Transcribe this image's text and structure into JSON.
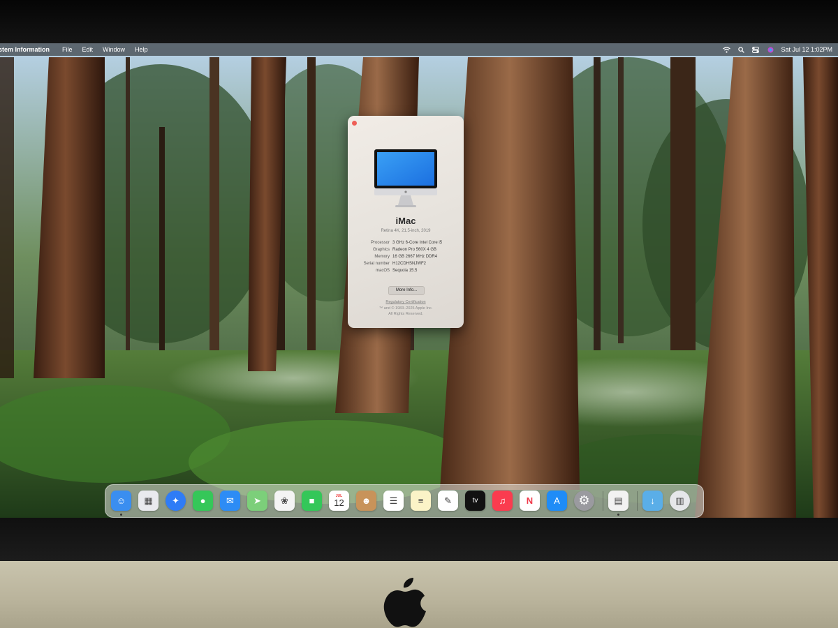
{
  "menubar": {
    "app_name": "stem Information",
    "menus": [
      "File",
      "Edit",
      "Window",
      "Help"
    ],
    "status_icons": [
      "wifi-icon",
      "search-icon",
      "control-center-icon",
      "siri-icon"
    ],
    "clock": "Sat Jul 12  1:02PM"
  },
  "about": {
    "model": "iMac",
    "subtitle": "Retina 4K, 21.5-inch, 2019",
    "specs": [
      {
        "key": "Processor",
        "value": "3 GHz 6-Core Intel Core i5"
      },
      {
        "key": "Graphics",
        "value": "Radeon Pro 560X 4 GB"
      },
      {
        "key": "Memory",
        "value": "16 GB 2667 MHz DDR4"
      },
      {
        "key": "Serial number",
        "value": "H12CDHSNJWF2"
      },
      {
        "key": "macOS",
        "value": "Sequoia 15.5"
      }
    ],
    "more_info_label": "More Info...",
    "regulatory_label": "Regulatory Certification",
    "copyright_line1": "™ and © 1983–2025 Apple Inc.",
    "copyright_line2": "All Rights Reserved."
  },
  "dock": {
    "apps": [
      {
        "name": "finder",
        "icon": "finder-icon",
        "color": "#3a8ef0",
        "glyph": "☺",
        "running": true
      },
      {
        "name": "launchpad",
        "icon": "launchpad-icon",
        "color": "#e9eaee",
        "glyph": "▦",
        "running": false
      },
      {
        "name": "safari",
        "icon": "safari-icon",
        "color": "#2f7cf6",
        "glyph": "✦",
        "running": false
      },
      {
        "name": "messages",
        "icon": "messages-icon",
        "color": "#35c759",
        "glyph": "●",
        "running": false
      },
      {
        "name": "mail",
        "icon": "mail-icon",
        "color": "#2d8cf5",
        "glyph": "✉",
        "running": false
      },
      {
        "name": "maps",
        "icon": "maps-icon",
        "color": "#7ccf7a",
        "glyph": "➤",
        "running": false
      },
      {
        "name": "photos",
        "icon": "photos-icon",
        "color": "#f4f4f4",
        "glyph": "❀",
        "running": false
      },
      {
        "name": "facetime",
        "icon": "facetime-icon",
        "color": "#34c759",
        "glyph": "■",
        "running": false
      },
      {
        "name": "calendar",
        "icon": "calendar-icon",
        "color": "#ffffff",
        "glyph": "12",
        "month": "JUL",
        "running": false
      },
      {
        "name": "contacts",
        "icon": "contacts-icon",
        "color": "#c8935a",
        "glyph": "☻",
        "running": false
      },
      {
        "name": "reminders",
        "icon": "reminders-icon",
        "color": "#ffffff",
        "glyph": "☰",
        "running": false
      },
      {
        "name": "notes",
        "icon": "notes-icon",
        "color": "#fbf3c7",
        "glyph": "≡",
        "running": false
      },
      {
        "name": "freeform",
        "icon": "freeform-icon",
        "color": "#ffffff",
        "glyph": "✎",
        "running": false
      },
      {
        "name": "tv",
        "icon": "apple-tv-icon",
        "color": "#111111",
        "glyph": "tv",
        "running": false
      },
      {
        "name": "music",
        "icon": "music-icon",
        "color": "#fa3c4f",
        "glyph": "♫",
        "running": false
      },
      {
        "name": "news",
        "icon": "news-icon",
        "color": "#ffffff",
        "glyph": "N",
        "running": false
      },
      {
        "name": "app-store",
        "icon": "app-store-icon",
        "color": "#1f8cf7",
        "glyph": "A",
        "running": false
      },
      {
        "name": "system-settings",
        "icon": "system-settings-icon",
        "color": "#9a9a9f",
        "glyph": "⚙",
        "running": false
      },
      {
        "name": "system-information",
        "icon": "system-information-icon",
        "color": "#f2f2f2",
        "glyph": "▤",
        "running": true
      },
      {
        "name": "downloads",
        "icon": "downloads-folder-icon",
        "color": "#5aaee8",
        "glyph": "↓",
        "running": false
      },
      {
        "name": "trash",
        "icon": "trash-icon",
        "color": "#e6e7ea",
        "glyph": "▥",
        "running": false
      }
    ]
  }
}
